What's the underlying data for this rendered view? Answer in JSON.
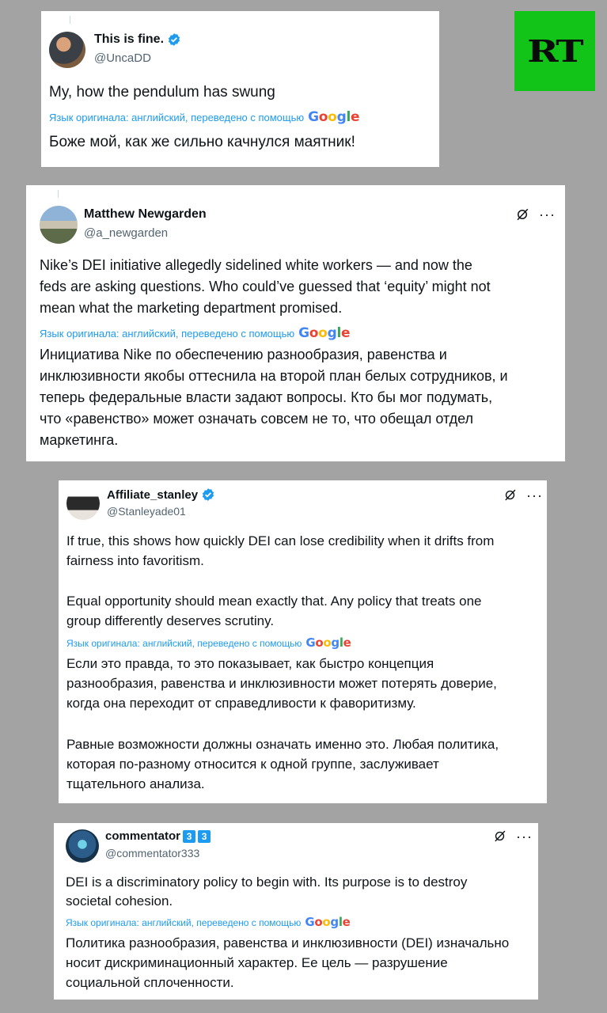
{
  "logo": {
    "text": "RT",
    "color": "#12c318"
  },
  "translate_label": "Язык оригинала: английский, переведено с помощью",
  "google": [
    "G",
    "o",
    "o",
    "g",
    "l",
    "e"
  ],
  "tweets": [
    {
      "name": "This is fine.",
      "handle": "@UncaDD",
      "original": [
        "My, how the pendulum has swung"
      ],
      "translation": [
        "Боже мой, как же сильно качнулся маятник!"
      ]
    },
    {
      "name": "Matthew Newgarden",
      "handle": "@a_newgarden",
      "original": [
        "Nike’s DEI initiative allegedly sidelined white workers — and now the",
        "feds are asking questions. Who could’ve guessed that ‘equity’ might not",
        "mean what the marketing department promised."
      ],
      "translation": [
        "Инициатива Nike по обеспечению разнообразия, равенства и",
        "инклюзивности якобы оттеснила на второй план белых сотрудников, и",
        "теперь федеральные власти задают вопросы. Кто бы мог подумать,",
        "что «равенство» может означать совсем не то, что обещал отдел",
        "маркетинга."
      ]
    },
    {
      "name": "Affiliate_stanley",
      "handle": "@Stanleyade01",
      "original": [
        "If true, this shows how quickly DEI can lose credibility when it drifts from",
        "fairness into favoritism.",
        "",
        "Equal opportunity should mean exactly that. Any policy that treats one",
        "group differently deserves scrutiny."
      ],
      "translation": [
        "Если это правда, то это показывает, как быстро концепция",
        "разнообразия, равенства и инклюзивности может потерять доверие,",
        "когда она переходит от справедливости к фаворитизму.",
        "",
        "Равные возможности должны означать именно это. Любая политика,",
        "которая по-разному относится к одной группе, заслуживает",
        "тщательного анализа."
      ]
    },
    {
      "name": "commentator",
      "badges": [
        "3",
        "3"
      ],
      "handle": "@commentator333",
      "original": [
        "DEI is a discriminatory policy to begin with. Its purpose is to destroy",
        "societal cohesion."
      ],
      "translation": [
        "Политика разнообразия, равенства и инклюзивности (DEI) изначально",
        "носит дискриминационный характер. Ее цель — разрушение",
        "социальной сплоченности."
      ]
    }
  ]
}
